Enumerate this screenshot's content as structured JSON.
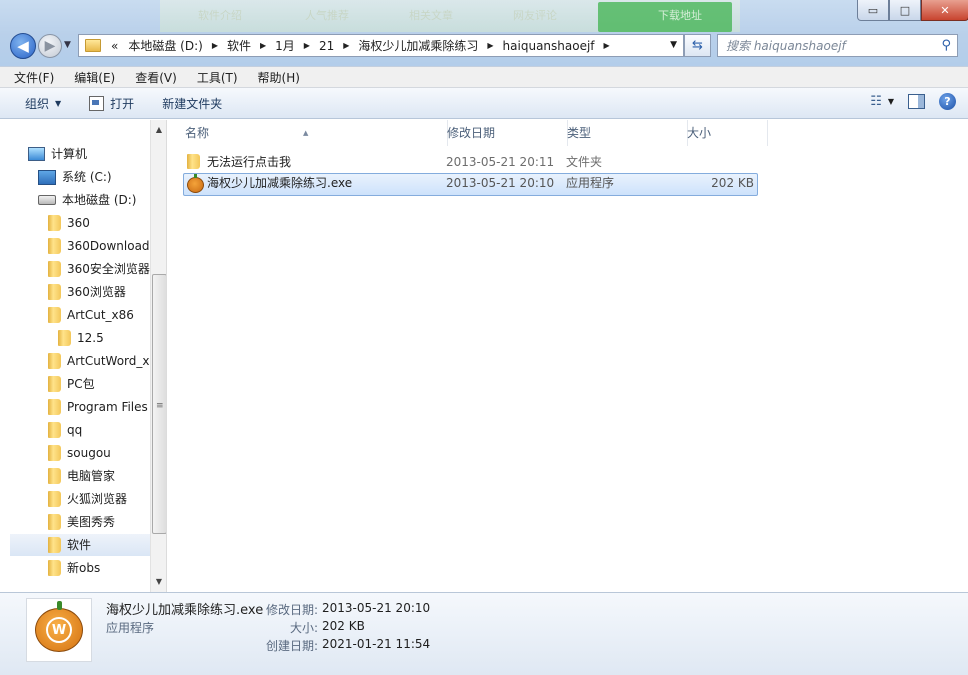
{
  "background_tabs": [
    "软件介绍",
    "人气推荐",
    "相关文章",
    "网友评论",
    "下载地址"
  ],
  "window_controls": {
    "minimize": "▭",
    "maximize": "□",
    "close": "✕"
  },
  "address": {
    "overflow": "«",
    "crumbs": [
      "本地磁盘 (D:)",
      "软件",
      "1月",
      "21",
      "海权少儿加减乘除练习",
      "haiquanshaoejf"
    ]
  },
  "search": {
    "placeholder": "搜索 haiquanshaoejf"
  },
  "menu": [
    "文件(F)",
    "编辑(E)",
    "查看(V)",
    "工具(T)",
    "帮助(H)"
  ],
  "toolbar": {
    "organize": "组织",
    "open": "打开",
    "new_folder": "新建文件夹"
  },
  "nav": {
    "computer": "计算机",
    "drive_c": "系统 (C:)",
    "drive_d": "本地磁盘 (D:)",
    "folders": [
      "360",
      "360Download",
      "360安全浏览器",
      "360浏览器",
      "ArtCut_x86",
      "12.5",
      "ArtCutWord_x",
      "PC包",
      "Program Files",
      "qq",
      "sougou",
      "电脑管家",
      "火狐浏览器",
      "美图秀秀",
      "软件",
      "新obs"
    ]
  },
  "columns": {
    "name": "名称",
    "modified": "修改日期",
    "type": "类型",
    "size": "大小"
  },
  "files": [
    {
      "name": "无法运行点击我",
      "modified": "2013-05-21 20:11",
      "type": "文件夹",
      "size": ""
    },
    {
      "name": "海权少儿加减乘除练习.exe",
      "modified": "2013-05-21 20:10",
      "type": "应用程序",
      "size": "202 KB"
    }
  ],
  "details": {
    "filename": "海权少儿加减乘除练习.exe",
    "filetype": "应用程序",
    "modified_label": "修改日期:",
    "modified": "2013-05-21 20:10",
    "size_label": "大小:",
    "size": "202 KB",
    "created_label": "创建日期:",
    "created": "2021-01-21 11:54"
  }
}
